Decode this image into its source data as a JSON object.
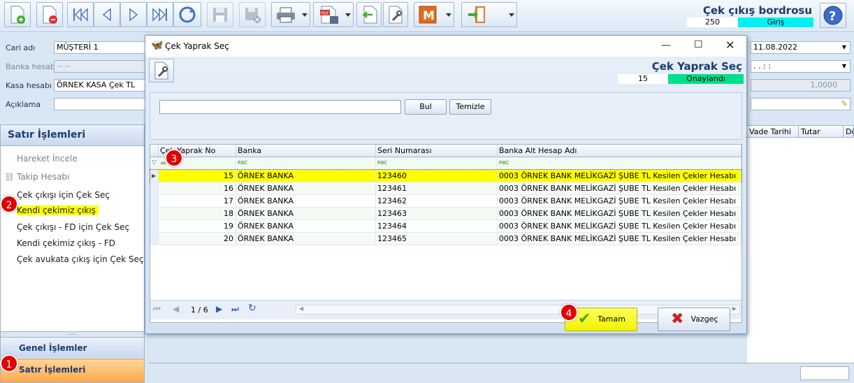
{
  "form": {
    "title": "Çek çıkış bordrosu",
    "doc_number": "250",
    "doc_status": "Giriş",
    "cari_label": "Cari adı",
    "cari_value": "MÜŞTERİ 1",
    "banka_label": "Banka hesabı",
    "banka_value": "-- --",
    "kasa_label": "Kasa hesabı",
    "kasa_value": "ÖRNEK KASA Çek TL",
    "aciklama_label": "Açıklama",
    "date_value": "11.08.2022",
    "time_value": ".  .     :  :",
    "rate_value": "1,0000"
  },
  "right_grid": {
    "columns": [
      "Vade Tarihi",
      "Tutar",
      "Dö"
    ]
  },
  "left_panel": {
    "header": "Satır İşlemleri",
    "items": [
      "Hareket İncele",
      "Takip Hesabı",
      "Çek çıkışı için Çek Seç",
      "Kendi çekimiz çıkış",
      "Çek çıkışı - FD için Çek Seç",
      "Kendi çekimiz çıkış - FD",
      "Çek avukata çıkış için Çek Seç"
    ],
    "grip": ".....",
    "nav": [
      "Genel İşlemler",
      "Satır İşlemleri"
    ]
  },
  "badges": [
    "1",
    "2",
    "3",
    "4"
  ],
  "dialog": {
    "window_title": "Çek Yaprak Seç",
    "header_title": "Çek Yaprak Seç",
    "count": "15",
    "status": "Onaylandı",
    "search_value": "",
    "find_label": "Bul",
    "clear_label": "Temizle",
    "columns": [
      "Çek Yaprak No",
      "Banka",
      "Seri Numarası",
      "Banka Alt Hesap Adı"
    ],
    "filter_icons": [
      "=",
      "RBC",
      "RBC",
      "RBC"
    ],
    "rows": [
      {
        "no": "15",
        "bank": "ÖRNEK BANKA",
        "serial": "123460",
        "account": "0003 ÖRNEK BANK MELİKGAZİ ŞUBE TL Kesilen Çekler Hesabı"
      },
      {
        "no": "16",
        "bank": "ÖRNEK BANKA",
        "serial": "123461",
        "account": "0003 ÖRNEK BANK MELİKGAZİ ŞUBE TL Kesilen Çekler Hesabı"
      },
      {
        "no": "17",
        "bank": "ÖRNEK BANKA",
        "serial": "123462",
        "account": "0003 ÖRNEK BANK MELİKGAZİ ŞUBE TL Kesilen Çekler Hesabı"
      },
      {
        "no": "18",
        "bank": "ÖRNEK BANKA",
        "serial": "123463",
        "account": "0003 ÖRNEK BANK MELİKGAZİ ŞUBE TL Kesilen Çekler Hesabı"
      },
      {
        "no": "19",
        "bank": "ÖRNEK BANKA",
        "serial": "123464",
        "account": "0003 ÖRNEK BANK MELİKGAZİ ŞUBE TL Kesilen Çekler Hesabı"
      },
      {
        "no": "20",
        "bank": "ÖRNEK BANKA",
        "serial": "123465",
        "account": "0003 ÖRNEK BANK MELİKGAZİ ŞUBE TL Kesilen Çekler Hesabı"
      }
    ],
    "pager": "1 / 6",
    "ok_label": "Tamam",
    "cancel_label": "Vazgeç"
  },
  "colors": {
    "highlight": "#ffff00",
    "onay": "#00e08a",
    "giris": "#00f0f8",
    "badge": "#e00000",
    "active_nav": "#ffb74d"
  }
}
